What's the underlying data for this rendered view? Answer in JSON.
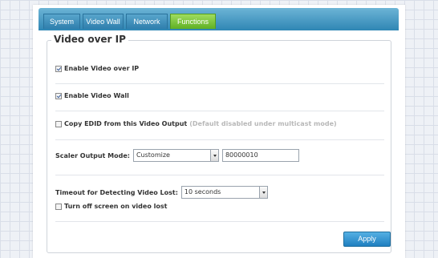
{
  "tabs": {
    "system": "System",
    "video_wall": "Video Wall",
    "network": "Network",
    "functions": "Functions"
  },
  "section": {
    "title": "Video over IP"
  },
  "options": {
    "enable_video_over_ip": {
      "label": "Enable Video over IP",
      "checked": true
    },
    "enable_video_wall": {
      "label": "Enable Video Wall",
      "checked": true
    },
    "copy_edid": {
      "label": "Copy EDID from this Video Output",
      "note": "(Default disabled under multicast mode)",
      "checked": false
    },
    "turn_off_screen": {
      "label": "Turn off screen on video lost",
      "checked": false
    }
  },
  "scaler": {
    "label": "Scaler Output Mode:",
    "selected": "Customize",
    "value": "80000010"
  },
  "timeout": {
    "label": "Timeout for Detecting Video Lost:",
    "selected": "10 seconds"
  },
  "apply_label": "Apply",
  "colors": {
    "tab_bar": "#2f86b4",
    "active_tab": "#5fb023",
    "apply_button": "#1f7fc0",
    "note_text": "#b8b8b8"
  }
}
